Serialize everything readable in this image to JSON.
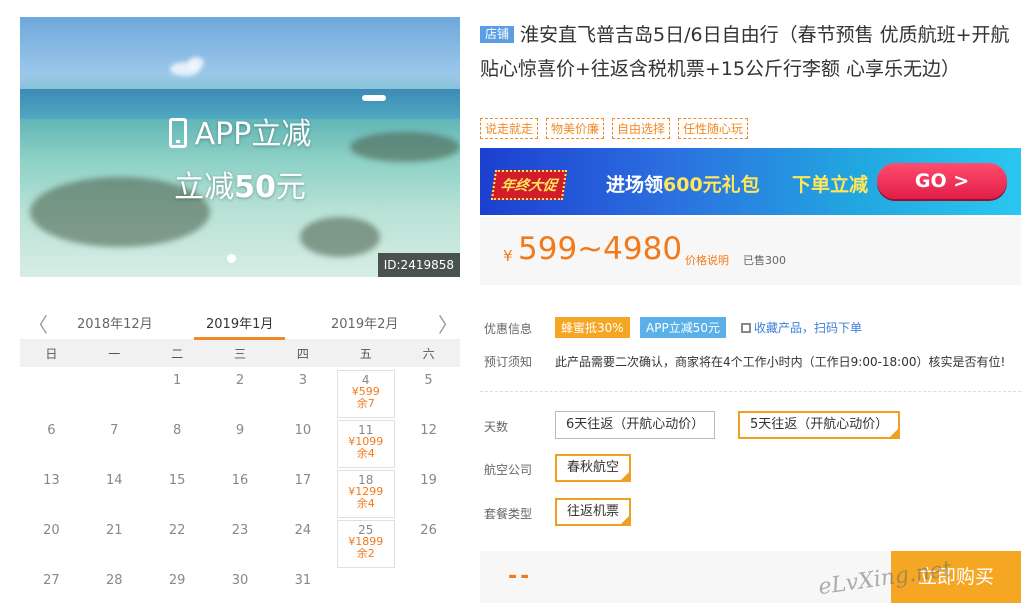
{
  "hero": {
    "promo_line1": "APP立减",
    "promo_line2_prefix": "立减",
    "promo_line2_amount": "50",
    "promo_line2_suffix": "元",
    "id_badge": "ID:2419858"
  },
  "product": {
    "shop_tag": "店铺",
    "title": "淮安直飞普吉岛5日/6日自由行（春节预售 优质航班+开航贴心惊喜价+往返含税机票+15公斤行李额 心享乐无边）",
    "tags": [
      "说走就走",
      "物美价廉",
      "自由选择",
      "任性随心玩"
    ]
  },
  "banner": {
    "badge": "年终大促",
    "text1_prefix": "进场领",
    "text1_highlight": "600元礼包",
    "text2": "下单立减",
    "go_label": "GO >"
  },
  "price": {
    "yen": "¥",
    "range": "599~4980",
    "note": "价格说明",
    "sold": "已售300"
  },
  "calendar": {
    "prev_arrow": "〈",
    "next_arrow": "〉",
    "months": [
      "2018年12月",
      "2019年1月",
      "2019年2月"
    ],
    "active_month": "2019年1月",
    "weekdays": [
      "日",
      "一",
      "二",
      "三",
      "四",
      "五",
      "六"
    ],
    "days": [
      {
        "d": ""
      },
      {
        "d": ""
      },
      {
        "d": "1"
      },
      {
        "d": "2"
      },
      {
        "d": "3"
      },
      {
        "d": "4",
        "p": "¥599",
        "r": "余7"
      },
      {
        "d": "5"
      },
      {
        "d": "6"
      },
      {
        "d": "7"
      },
      {
        "d": "8"
      },
      {
        "d": "9"
      },
      {
        "d": "10"
      },
      {
        "d": "11",
        "p": "¥1099",
        "r": "余4"
      },
      {
        "d": "12"
      },
      {
        "d": "13"
      },
      {
        "d": "14"
      },
      {
        "d": "15"
      },
      {
        "d": "16"
      },
      {
        "d": "17"
      },
      {
        "d": "18",
        "p": "¥1299",
        "r": "余4"
      },
      {
        "d": "19"
      },
      {
        "d": "20"
      },
      {
        "d": "21"
      },
      {
        "d": "22"
      },
      {
        "d": "23"
      },
      {
        "d": "24"
      },
      {
        "d": "25",
        "p": "¥1899",
        "r": "余2"
      },
      {
        "d": "26"
      },
      {
        "d": "27"
      },
      {
        "d": "28"
      },
      {
        "d": "29"
      },
      {
        "d": "30"
      },
      {
        "d": "31"
      },
      {
        "d": ""
      },
      {
        "d": ""
      }
    ]
  },
  "info": {
    "discount_label": "优惠信息",
    "discount_pill1": "蜂蜜抵30%",
    "discount_pill2": "APP立减50元",
    "qr_link": "收藏产品，扫码下单",
    "notice_label": "预订须知",
    "notice_text": "此产品需要二次确认，商家将在4个工作小时内（工作日9:00-18:00）核实是否有位!",
    "days_label": "天数",
    "days_options": [
      "6天往返（开航心动价）",
      "5天往返（开航心动价）"
    ],
    "airline_label": "航空公司",
    "airline_option": "春秋航空",
    "package_label": "套餐类型",
    "package_option": "往返机票"
  },
  "buy": {
    "price_placeholder": "--",
    "button_label": "立即购买"
  },
  "watermark": "eLvXing.net",
  "colors": {
    "accent": "#f27a1a",
    "link": "#3a7fd8",
    "pill_orange": "#f5a623",
    "pill_blue": "#5ab0e8"
  }
}
